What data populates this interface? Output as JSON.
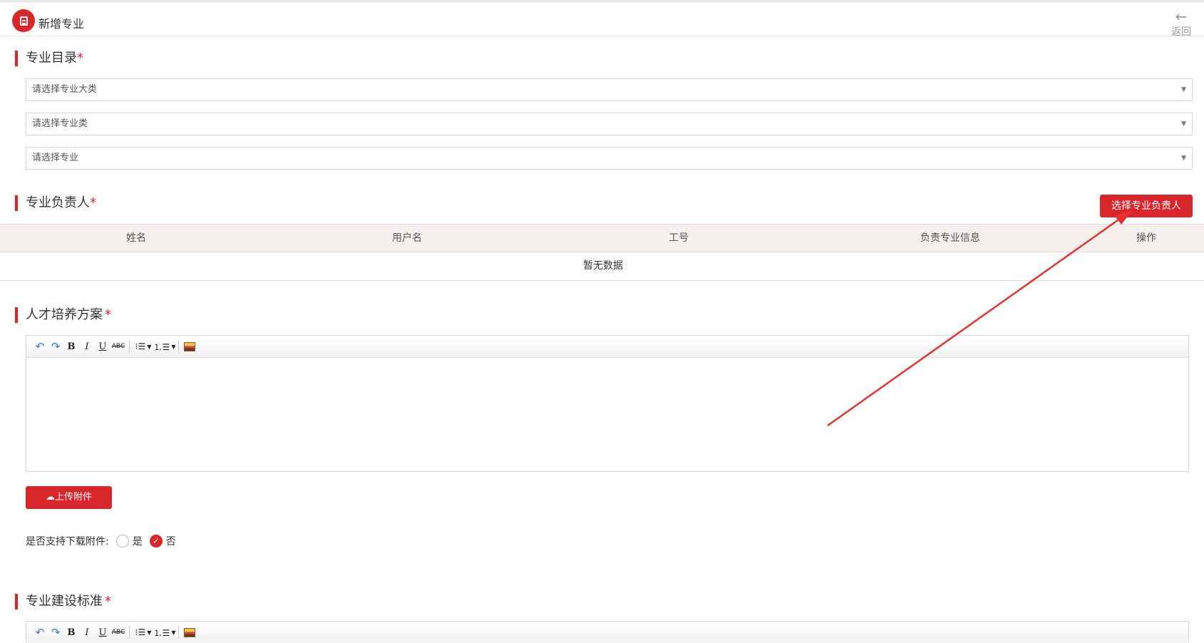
{
  "header": {
    "title": "新增专业",
    "back_label": "返回"
  },
  "sections": {
    "catalog": {
      "title": "专业目录",
      "required_mark": "*"
    },
    "leader": {
      "title": "专业负责人",
      "required_mark": "*"
    },
    "training_plan": {
      "title": "人才培养方案",
      "required_mark": "*"
    },
    "construction_standard": {
      "title": "专业建设标准",
      "required_mark": "*"
    }
  },
  "selects": {
    "category_placeholder": "请选择专业大类",
    "class_placeholder": "请选择专业类",
    "major_placeholder": "请选择专业"
  },
  "buttons": {
    "select_leader": "选择专业负责人",
    "upload_attachment": "上传附件"
  },
  "table": {
    "columns": [
      "姓名",
      "用户名",
      "工号",
      "负责专业信息",
      "操作"
    ],
    "empty_text": "暂无数据"
  },
  "download_option": {
    "label": "是否支持下载附件:",
    "options": [
      "是",
      "否"
    ],
    "selected": "否"
  },
  "colors": {
    "accent": "#d9262b",
    "table_header_bg": "#f5efed"
  },
  "icons": {
    "logo": "document-icon",
    "back": "arrow-left-icon",
    "upload": "cloud-upload-icon"
  }
}
